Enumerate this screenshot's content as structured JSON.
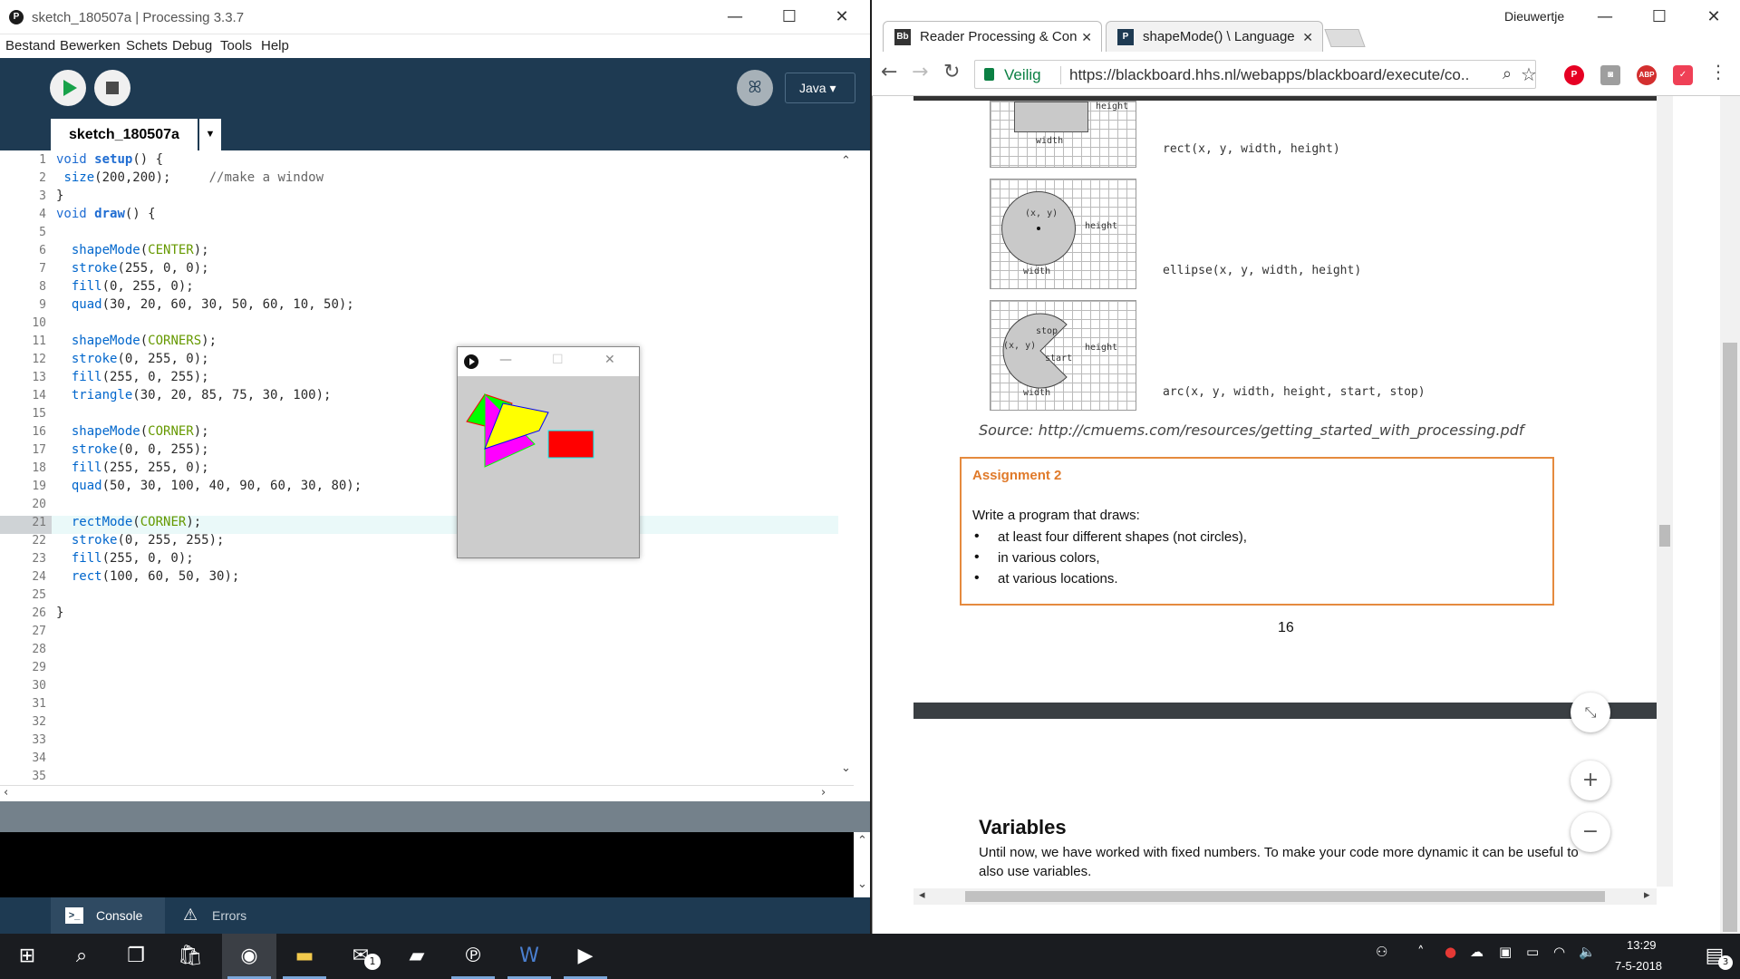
{
  "processing": {
    "title": "sketch_180507a | Processing 3.3.7",
    "logo": "P",
    "menu": [
      "Bestand",
      "Bewerken",
      "Schets",
      "Debug",
      "Tools",
      "Help"
    ],
    "mode": "Java ▾",
    "tab": "sketch_180507a",
    "tab_menu": "▼",
    "code_lines": [
      "void setup() {",
      " size(200,200);     //make a window",
      "}",
      "void draw() {",
      "",
      "  shapeMode(CENTER);",
      "  stroke(255, 0, 0);",
      "  fill(0, 255, 0);",
      "  quad(30, 20, 60, 30, 50, 60, 10, 50);",
      "",
      "  shapeMode(CORNERS);",
      "  stroke(0, 255, 0);",
      "  fill(255, 0, 255);",
      "  triangle(30, 20, 85, 75, 30, 100);",
      "",
      "  shapeMode(CORNER);",
      "  stroke(0, 0, 255);",
      "  fill(255, 255, 0);",
      "  quad(50, 30, 100, 40, 90, 60, 30, 80);",
      "",
      "  rectMode(CORNER);",
      "  stroke(0, 255, 255);",
      "  fill(255, 0, 0);",
      "  rect(100, 60, 50, 30);",
      "",
      "}",
      "",
      "",
      "",
      "",
      "",
      "",
      "",
      "",
      ""
    ],
    "highlighted_line": 21,
    "console_tab": "Console",
    "errors_tab": "Errors"
  },
  "sketch_window": {
    "canvas_color": "#cccccc"
  },
  "chrome": {
    "tabs": [
      {
        "favicon": "Bb",
        "label": "Reader Processing & Con"
      },
      {
        "favicon": "P",
        "label": "shapeMode() \\ Language"
      }
    ],
    "profile": "Dieuwertje",
    "secure_label": "Veilig",
    "url": "https://blackboard.hhs.nl/webapps/blackboard/execute/co...",
    "extensions": [
      "pinterest-icon",
      "camera-icon",
      "adblock-icon",
      "pocket-icon"
    ]
  },
  "pdf": {
    "figures": [
      {
        "caption": "rect(x, y, width, height)",
        "labels": [
          "height",
          "width"
        ]
      },
      {
        "caption": "ellipse(x, y, width, height)",
        "labels": [
          "(x, y)",
          "height",
          "width"
        ]
      },
      {
        "caption": "arc(x, y, width, height, start, stop)",
        "labels": [
          "(x, y)",
          "stop",
          "start",
          "height",
          "width"
        ]
      }
    ],
    "source": "Source: http://cmuems.com/resources/getting_started_with_processing.pdf",
    "assignment": {
      "title": "Assignment 2",
      "intro": "Write a program that draws:",
      "bullets": [
        "at least four different shapes (not circles),",
        "in various colors,",
        "at various locations."
      ]
    },
    "page_number": "16",
    "variables_title": "Variables",
    "variables_body": "Until now, we have worked with fixed numbers. To make your code more dynamic it can be useful to also use variables.",
    "zoom_in": "+",
    "zoom_out": "−"
  },
  "taskbar": {
    "time": "13:29",
    "date": "7-5-2018",
    "mail_badge": "1",
    "notification_badge": "3"
  },
  "colors": {
    "processing_dark": "#1e3a52",
    "run_green": "#18a24a",
    "assignment_orange": "#e58a3e"
  }
}
